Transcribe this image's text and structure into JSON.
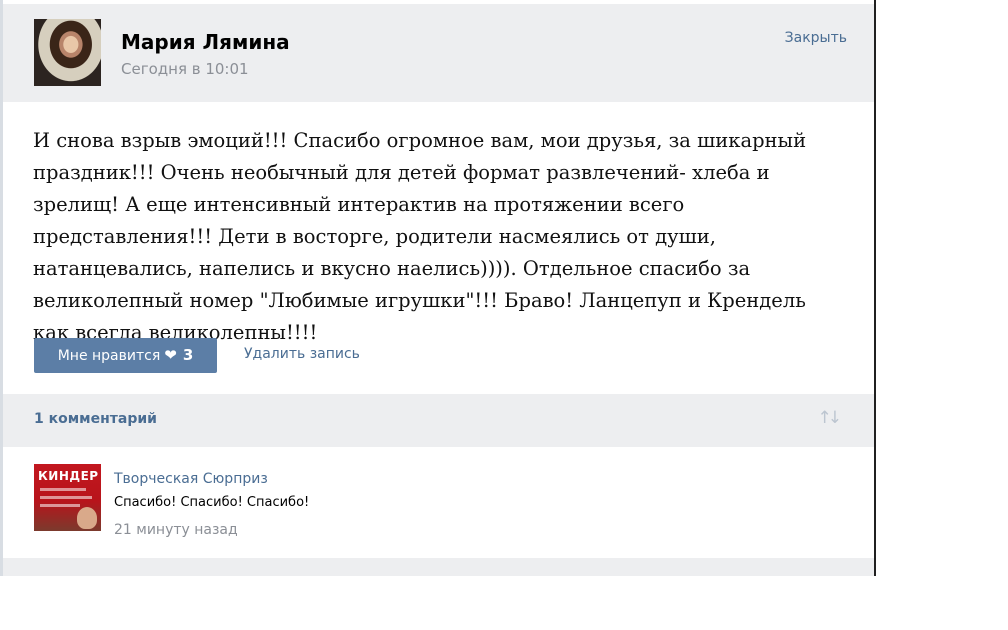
{
  "post": {
    "author_name": "Мария Лямина",
    "timestamp": "Сегодня в 10:01",
    "close_label": "Закрыть",
    "text": "И снова взрыв эмоций!!! Спасибо огромное вам, мои друзья, за шикарный праздник!!! Очень необычный для детей формат развлечений- хлеба и зрелищ! А еще интенсивный интерактив на протяжении всего представления!!! Дети в восторге, родители насмеялись от души, натанцевались, напелись и вкусно наелись)))). Отдельное спасибо за великолепный номер \"Любимые игрушки\"!!! Браво! Ланцепуп и Крендель как всегда великолепны!!!!",
    "like_label": "Мне нравится",
    "like_count": "3",
    "delete_label": "Удалить запись"
  },
  "comments": {
    "count_label": "1 комментарий",
    "items": [
      {
        "author": "Творческая Сюрприз",
        "text": "Спасибо! Спасибо! Спасибо!",
        "time": "21 минуту назад",
        "avatar_text": "КИНДЕР"
      }
    ]
  },
  "icons": {
    "heart": "heart-icon",
    "sort": "sort-arrows-icon"
  },
  "colors": {
    "link": "#4a6d93",
    "button": "#5c7ea6",
    "header_bg": "#edeef0",
    "muted_text": "#8b8f96"
  }
}
